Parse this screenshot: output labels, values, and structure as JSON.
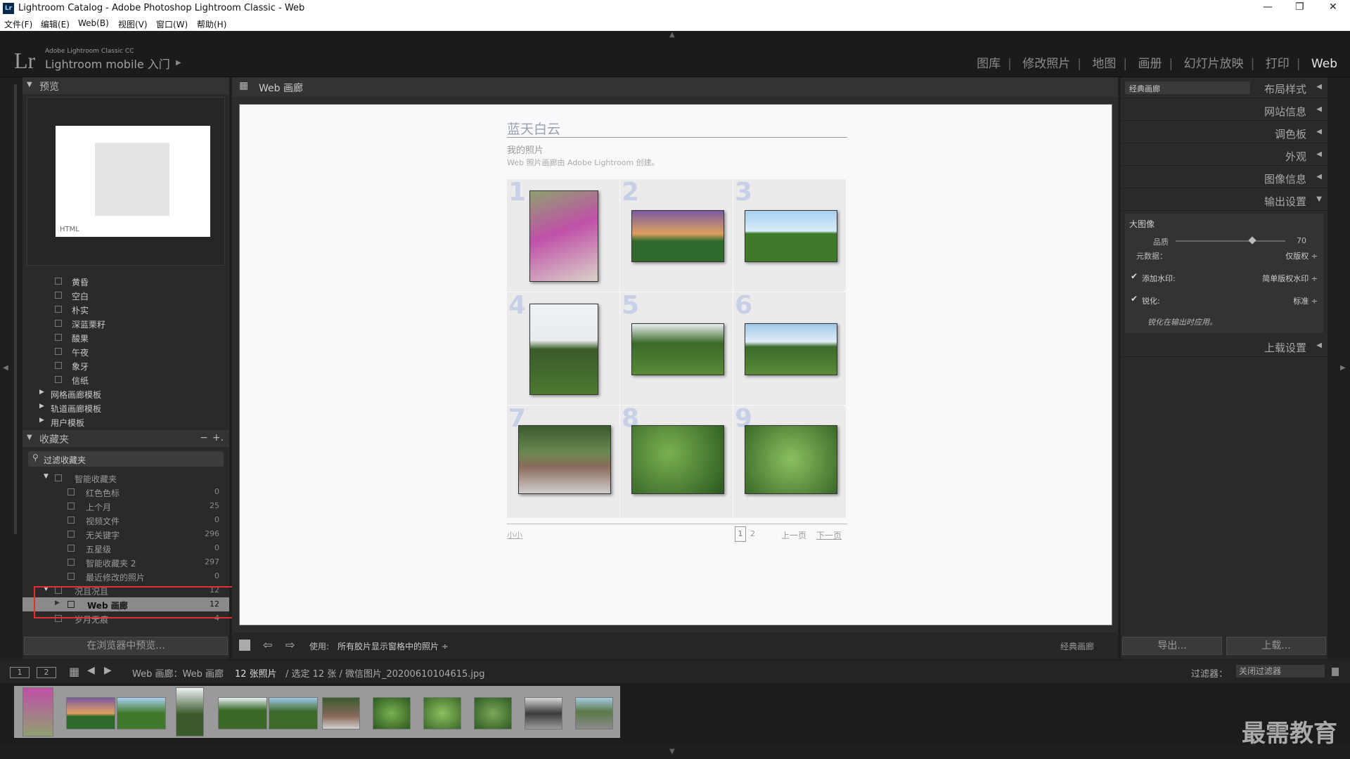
{
  "window": {
    "title": "Lightroom Catalog - Adobe Photoshop Lightroom Classic - Web",
    "icon_label": "Lr"
  },
  "menu": [
    "文件(F)",
    "编辑(E)",
    "Web(B)",
    "视图(V)",
    "窗口(W)",
    "帮助(H)"
  ],
  "identity": {
    "logo": "Lr",
    "line1": "Adobe Lightroom Classic CC",
    "line2": "Lightroom mobile 入门"
  },
  "modules": [
    "图库",
    "修改照片",
    "地图",
    "画册",
    "幻灯片放映",
    "打印",
    "Web"
  ],
  "active_module": "Web",
  "left": {
    "preview_header": "预览",
    "preview_html_label": "HTML",
    "templates": [
      "黄昏",
      "空白",
      "朴实",
      "深蓝栗籽",
      "酸果",
      "午夜",
      "象牙",
      "信纸"
    ],
    "template_groups": [
      "网格画廊模板",
      "轨道画廊模板",
      "用户模板"
    ],
    "collections_header": "收藏夹",
    "collections_minus": "−",
    "collections_plus": "+.",
    "filter_placeholder": "过滤收藏夹",
    "smart_folder": "智能收藏夹",
    "smart_items": [
      {
        "name": "红色色标",
        "count": "0"
      },
      {
        "name": "上个月",
        "count": "25"
      },
      {
        "name": "视频文件",
        "count": "0"
      },
      {
        "name": "无关键字",
        "count": "296"
      },
      {
        "name": "五星级",
        "count": "0"
      },
      {
        "name": "智能收藏夹 2",
        "count": "297"
      },
      {
        "name": "最近修改的照片",
        "count": "0"
      }
    ],
    "folder": {
      "name": "况且况且",
      "count": "12"
    },
    "selected": {
      "name": "Web 画廊",
      "count": "12"
    },
    "folder2": {
      "name": "岁月无痕",
      "count": "4"
    },
    "preview_button": "在浏览器中预览..."
  },
  "center": {
    "header": "Web 画廊",
    "site_title": "蓝天白云",
    "collection_title": "我的照片",
    "collection_desc": "Web 照片画廊由 Adobe Lightroom 创建。",
    "numbers": [
      "1",
      "2",
      "3",
      "4",
      "5",
      "6",
      "7",
      "8",
      "9"
    ],
    "footer_left": "小小",
    "pages": [
      "1",
      "2"
    ],
    "prev": "上一页",
    "next": "下一页",
    "toolbar_use": "使用:",
    "toolbar_source": "所有胶片显示窗格中的照片 ÷",
    "toolbar_right": "经典画廊"
  },
  "right": {
    "layout_select": "经典画廊",
    "sections": [
      "布局样式",
      "网站信息",
      "调色板",
      "外观",
      "图像信息",
      "输出设置"
    ],
    "output": {
      "title": "大图像",
      "quality_label": "品质",
      "quality_value": "70",
      "quality_fraction": 0.7,
      "metadata_label": "元数据：",
      "metadata_value": "仅版权 ÷",
      "watermark_label": "添加水印:",
      "watermark_value": "简单版权水印 ÷",
      "sharpen_label": "锐化:",
      "sharpen_value": "标准 ÷",
      "note": "锐化在输出时应用。"
    },
    "upload_section": "上载设置",
    "export_button": "导出...",
    "upload_button": "上载..."
  },
  "filmbar": {
    "view1": "1",
    "view2": "2",
    "path": "Web 画廊：Web 画廊",
    "count": "12 张照片",
    "selection": "/ 选定 12 张 / 微信图片_20200610104615.jpg",
    "filter_label": "过滤器：",
    "filter_value": "关闭过滤器"
  },
  "watermark_text": "最需教育",
  "colors": {
    "bg": "#1f1f1f",
    "panel": "#2a2a2a",
    "selected_outline": "#e03030"
  }
}
